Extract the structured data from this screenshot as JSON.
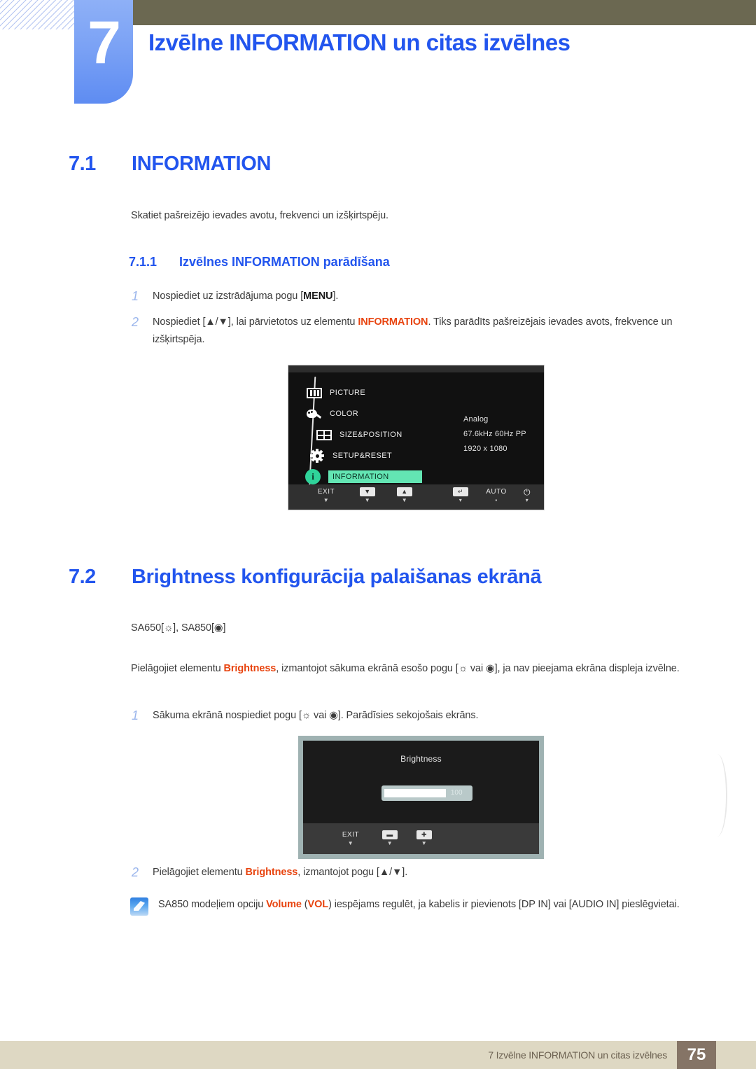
{
  "header": {
    "chapter_number": "7",
    "chapter_title": "Izvēlne INFORMATION un citas izvēlnes"
  },
  "section_71": {
    "number": "7.1",
    "title": "INFORMATION",
    "intro": "Skatiet pašreizējo ievades avotu, frekvenci un izšķirtspēju.",
    "sub_number": "7.1.1",
    "sub_title": "Izvēlnes INFORMATION parādīšana",
    "steps": [
      {
        "num": "1",
        "pre": "Nospiediet uz izstrādājuma pogu [",
        "key": "MENU",
        "post": "]."
      },
      {
        "num": "2",
        "pre": "Nospiediet [▲/▼], lai pārvietotos uz elementu ",
        "keyword": "INFORMATION",
        "post": ". Tiks parādīts pašreizējais ievades avots, frekvence un izšķirtspēja."
      }
    ]
  },
  "osd_information": {
    "menu_items": [
      {
        "icon": "picture-icon",
        "label": "PICTURE",
        "selected": false
      },
      {
        "icon": "color-palette-icon",
        "label": "COLOR",
        "selected": false
      },
      {
        "icon": "size-position-icon",
        "label": "SIZE&POSITION",
        "selected": false
      },
      {
        "icon": "gear-icon",
        "label": "SETUP&RESET",
        "selected": false
      },
      {
        "icon": "info-icon",
        "label": "INFORMATION",
        "selected": true
      }
    ],
    "info_lines": [
      "Analog",
      "67.6kHz 60Hz PP",
      "1920 x 1080"
    ],
    "footer_buttons": [
      {
        "label": "EXIT",
        "type": "text"
      },
      {
        "label": "▼",
        "type": "box"
      },
      {
        "label": "▲",
        "type": "box"
      },
      {
        "label": "↵",
        "type": "box"
      },
      {
        "label": "AUTO",
        "type": "text"
      },
      {
        "label": "⏻",
        "type": "text"
      }
    ]
  },
  "section_72": {
    "number": "7.2",
    "title": "Brightness konfigurācija palaišanas ekrānā",
    "models_line": "SA650[☼], SA850[◉]",
    "paragraph_pre": "Pielāgojiet elementu ",
    "paragraph_kw": "Brightness",
    "paragraph_post": ", izmantojot sākuma ekrānā esošo pogu [☼ vai ◉], ja nav pieejama ekrāna displeja izvēlne.",
    "step1": {
      "num": "1",
      "text": "Sākuma ekrānā nospiediet pogu [☼ vai ◉]. Parādīsies sekojošais ekrāns."
    },
    "step2": {
      "num": "2",
      "pre": "Pielāgojiet elementu ",
      "keyword": "Brightness",
      "post": ", izmantojot pogu [▲/▼]."
    }
  },
  "osd_brightness": {
    "title": "Brightness",
    "value": "100",
    "fill_percent": 72,
    "footer_buttons": [
      {
        "label": "EXIT",
        "type": "text"
      },
      {
        "label": "▬",
        "type": "box"
      },
      {
        "label": "✚",
        "type": "box"
      }
    ]
  },
  "note": {
    "icon": "note-pencil-icon",
    "pre": "SA850 modeļiem opciju ",
    "kw1": "Volume",
    "mid1": " (",
    "kw2": "VOL",
    "post": ") iespējams regulēt, ja kabelis ir pievienots [DP IN] vai [AUDIO IN] pieslēgvietai."
  },
  "footer": {
    "text": "7 Izvēlne INFORMATION un citas izvēlnes",
    "page": "75"
  },
  "colors": {
    "accent_blue": "#2255ee",
    "tab_blue": "#7ba2f5",
    "olive": "#6b6851",
    "highlight_green": "#63e5b3",
    "keyword_red": "#e8440f",
    "footer_beige": "#ded8c3",
    "footer_page_brown": "#857466"
  }
}
